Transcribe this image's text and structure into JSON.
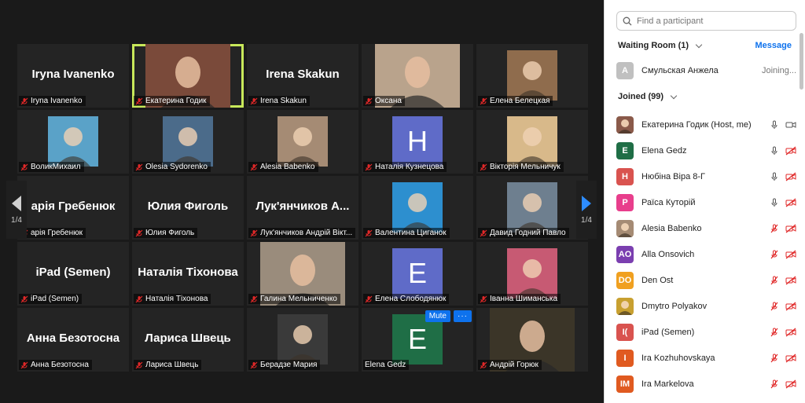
{
  "grid": {
    "tiles": [
      {
        "display": "Iryna Ivanenko",
        "label": "Iryna Ivanenko",
        "kind": "name"
      },
      {
        "label": "Екатерина Годик",
        "kind": "video",
        "active": true,
        "bg": "#7a4a3a"
      },
      {
        "display": "Irena Skakun",
        "label": "Irena Skakun",
        "kind": "name"
      },
      {
        "label": "Оксана",
        "kind": "video",
        "bg": "#b9a38c"
      },
      {
        "label": "Елена Белецкая",
        "kind": "photo",
        "bg": "#8f6c4d"
      },
      {
        "label": "ВоликМихаил",
        "kind": "photo",
        "bg": "#5aa2c8"
      },
      {
        "label": "Olesia Sydorenko",
        "kind": "photo",
        "bg": "#4b6b8a"
      },
      {
        "label": "Alesia Babenko",
        "kind": "photo",
        "bg": "#a58b74"
      },
      {
        "label": "Наталія Кузнецова",
        "kind": "letter",
        "letter": "H",
        "bg": "#5f6bc8"
      },
      {
        "label": "Вікторія Мельничук",
        "kind": "photo",
        "bg": "#d8b98a"
      },
      {
        "display": "арія Гребенюк",
        "label": "арія Гребенюк",
        "kind": "name"
      },
      {
        "display": "Юлия Фиголь",
        "label": "Юлия Фиголь",
        "kind": "name"
      },
      {
        "display": "Лук'янчиков  А...",
        "label": "Лук'янчиков Андрій Вікт...",
        "kind": "name"
      },
      {
        "label": "Валентина Циганок",
        "kind": "photo",
        "bg": "#2d8fcf"
      },
      {
        "label": "Давид Годний Павло",
        "kind": "photo",
        "bg": "#6e7f8f"
      },
      {
        "display": "iPad (Semen)",
        "label": "iPad (Semen)",
        "kind": "name"
      },
      {
        "display": "Наталія Тіхонова",
        "label": "Наталія Тіхонова",
        "kind": "name"
      },
      {
        "label": "Галина Мельниченко",
        "kind": "video",
        "bg": "#9a8c7c"
      },
      {
        "label": "Елена Слободянюк",
        "kind": "letter",
        "letter": "E",
        "bg": "#5f6bc8"
      },
      {
        "label": "Іванна Шиманська",
        "kind": "photo",
        "bg": "#c75a73"
      },
      {
        "display": "Анна Безотосна",
        "label": "Анна Безотосна",
        "kind": "name"
      },
      {
        "display": "Лариса Швець",
        "label": "Лариса Швець",
        "kind": "name"
      },
      {
        "label": "Берадзе Мария",
        "kind": "photo",
        "bg": "#3a3a3a"
      },
      {
        "label": "Elena Gedz",
        "kind": "letter",
        "letter": "E",
        "bg": "#1f6e46",
        "hover": true,
        "muted_mic": false
      },
      {
        "label": "Андрій Горюк",
        "kind": "video",
        "bg": "#3b3528"
      }
    ],
    "page_indicator_left": "1/4",
    "page_indicator_right": "1/4",
    "mute_button": "Mute",
    "more_button": "···"
  },
  "panel": {
    "search_placeholder": "Find a participant",
    "waiting_room_label": "Waiting Room (1)",
    "message_label": "Message",
    "waiting": {
      "name": "Смульская Анжела",
      "initial": "A",
      "status": "Joining...",
      "color": "#c0c0c0"
    },
    "joined_label": "Joined (99)",
    "participants": [
      {
        "name": "Екатерина Годик (Host, me)",
        "initial": "",
        "color": "#8a5a4a",
        "mic": "on",
        "cam": "on"
      },
      {
        "name": "Elena Gedz",
        "initial": "E",
        "color": "#1f6e46",
        "mic": "on",
        "cam": "off"
      },
      {
        "name": "Нюбіна Віра 8-Г",
        "initial": "H",
        "color": "#d9534f",
        "mic": "on",
        "cam": "off"
      },
      {
        "name": "Раїса Куторій",
        "initial": "P",
        "color": "#e83e8c",
        "mic": "on",
        "cam": "off"
      },
      {
        "name": "Alesia Babenko",
        "initial": "",
        "color": "#a58b74",
        "mic": "off",
        "cam": "off"
      },
      {
        "name": "Alla Onsovich",
        "initial": "AO",
        "color": "#7b3fb0",
        "mic": "off",
        "cam": "off"
      },
      {
        "name": "Den Ost",
        "initial": "DO",
        "color": "#f0a020",
        "mic": "off",
        "cam": "off"
      },
      {
        "name": "Dmytro Polyakov",
        "initial": "",
        "color": "#c8a030",
        "mic": "off",
        "cam": "off"
      },
      {
        "name": "iPad (Semen)",
        "initial": "I(",
        "color": "#d9534f",
        "mic": "off",
        "cam": "off"
      },
      {
        "name": "Ira Kozhuhovskaya",
        "initial": "I",
        "color": "#e05a20",
        "mic": "off",
        "cam": "off"
      },
      {
        "name": "Ira Markelova",
        "initial": "IM",
        "color": "#e05a20",
        "mic": "off",
        "cam": "off"
      }
    ]
  }
}
